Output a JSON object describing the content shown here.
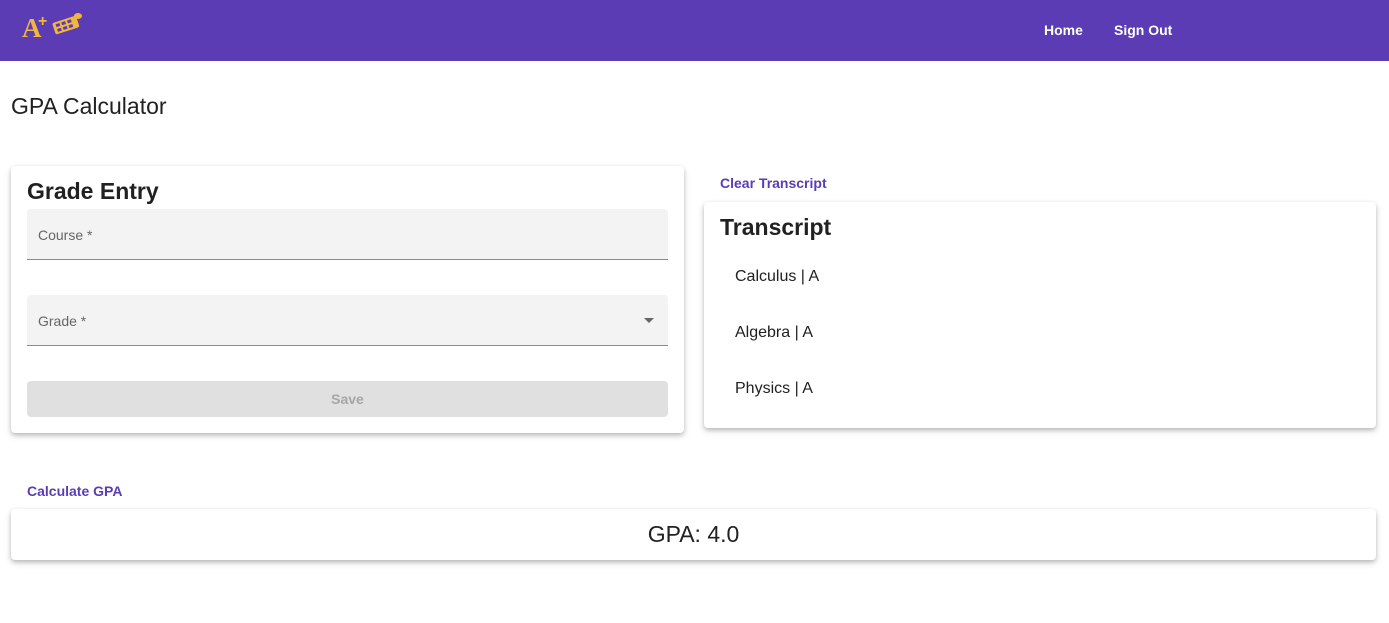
{
  "nav": {
    "home": "Home",
    "sign_out": "Sign Out"
  },
  "page_title": "GPA Calculator",
  "grade_entry": {
    "title": "Grade Entry",
    "course_label": "Course *",
    "grade_label": "Grade *",
    "save_label": "Save"
  },
  "clear_transcript": "Clear Transcript",
  "transcript": {
    "title": "Transcript",
    "items": [
      "Calculus | A",
      "Algebra | A",
      "Physics | A"
    ]
  },
  "calculate_gpa": "Calculate GPA",
  "gpa_text": "GPA: 4.0",
  "colors": {
    "primary": "#5b3cb4",
    "logo_gold": "#f0b73a"
  },
  "icons": {
    "logo": "a-plus-logo-icon",
    "dropdown": "caret-down-icon"
  }
}
